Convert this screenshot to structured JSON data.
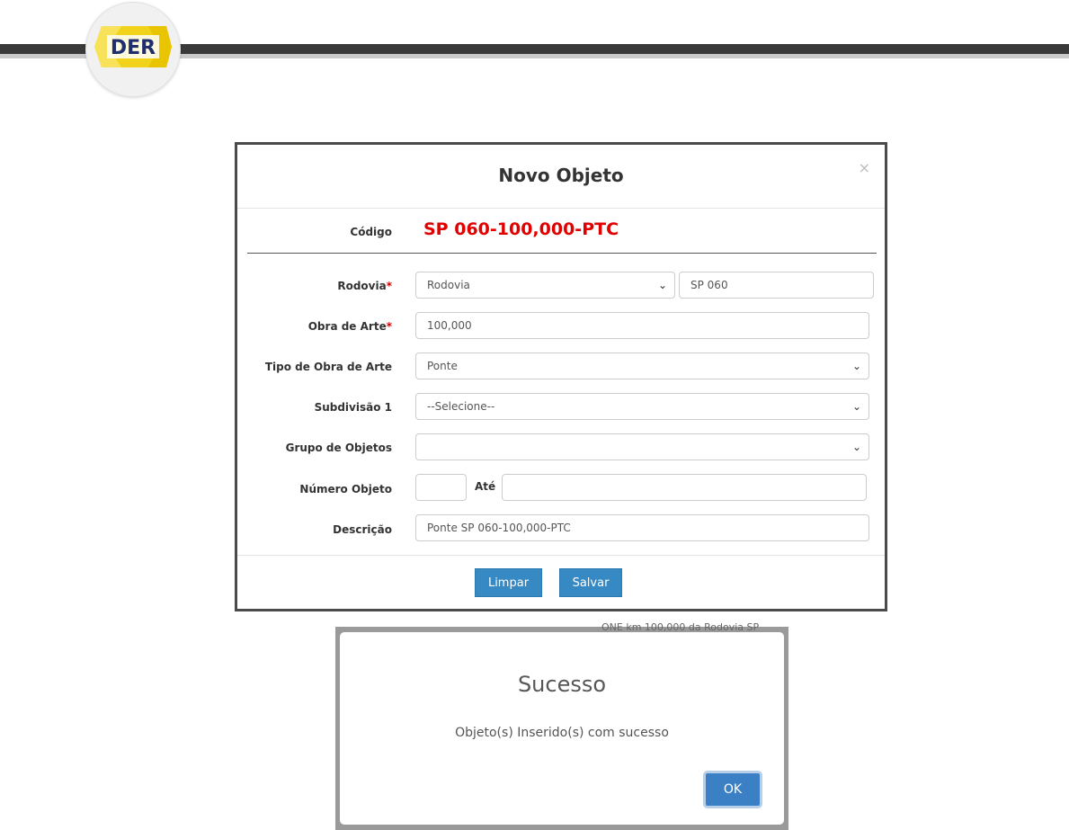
{
  "header": {
    "logo_text": "DER"
  },
  "modal": {
    "title": "Novo Objeto",
    "close_label": "×",
    "codigo_label": "Código",
    "codigo_value": "SP 060-100,000-PTC",
    "fields": {
      "rodovia_label": "Rodovia",
      "rodovia_select": "Rodovia",
      "rodovia_value": "SP 060",
      "obra_label": "Obra de Arte",
      "obra_value": "100,000",
      "tipo_label": "Tipo de Obra de Arte",
      "tipo_value": "Ponte",
      "subdivisao_label": "Subdivisão 1",
      "subdivisao_value": "--Selecione--",
      "grupo_label": "Grupo de Objetos",
      "grupo_value": "",
      "numero_label": "Número Objeto",
      "numero_from": "",
      "ate_label": "Até",
      "numero_to": "",
      "descricao_label": "Descrição",
      "descricao_value": "Ponte SP 060-100,000-PTC"
    },
    "required_marker": "*",
    "buttons": {
      "clear": "Limpar",
      "save": "Salvar"
    }
  },
  "alert": {
    "title": "Sucesso",
    "message": "Objeto(s) Inserido(s) com sucesso",
    "ok": "OK",
    "background_peek": "ONE km 100,000 da Rodovia SP"
  },
  "colors": {
    "accent": "#3689c2",
    "codigo": "#e00000",
    "logo_yellow": "#f2d31b"
  }
}
